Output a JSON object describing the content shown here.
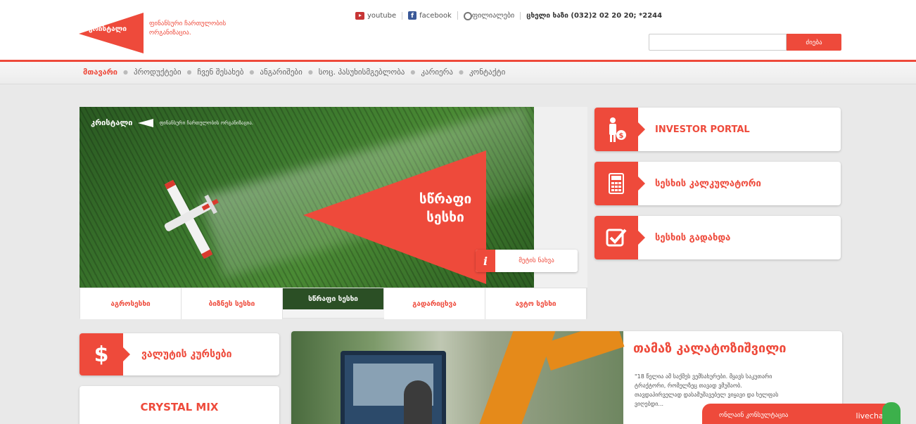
{
  "header": {
    "logo_text": "კრისტალი",
    "tagline": "ფინანსური ჩართულობის ორგანიზაცია.",
    "links": [
      {
        "label": "youtube",
        "icon": "youtube-icon"
      },
      {
        "label": "facebook",
        "icon": "facebook-icon"
      },
      {
        "label": "ფილიალები",
        "icon": "map-pin-icon"
      }
    ],
    "hotline": "ცხელი ხაზი (032)2 02 20 20; *2244",
    "search": {
      "placeholder": "",
      "button_label": "ძიება"
    }
  },
  "nav": {
    "items": [
      {
        "label": "მთავარი",
        "active": true
      },
      {
        "label": "პროდუქტები",
        "active": false
      },
      {
        "label": "ჩვენ შესახებ",
        "active": false
      },
      {
        "label": "ანგარიშები",
        "active": false
      },
      {
        "label": "სოც. პასუხისმგებლობა",
        "active": false
      },
      {
        "label": "კარიერა",
        "active": false
      },
      {
        "label": "კონტაქტი",
        "active": false
      }
    ]
  },
  "hero": {
    "brand": "კრისტალი",
    "brand_sub": "ფინანსური ჩართულობის ორგანიზაცია.",
    "title_line1": "სწრაფი",
    "title_line2": "სესხი",
    "more_label": "მეტის ნახვა"
  },
  "tabs": [
    {
      "label": "აგროსესხი",
      "active": false
    },
    {
      "label": "ბიზნეს სესხი",
      "active": false
    },
    {
      "label": "სწრაფი სესხი",
      "active": true
    },
    {
      "label": "გადარიცხვა",
      "active": false
    },
    {
      "label": "ავტო სესხი",
      "active": false
    }
  ],
  "side_cards": [
    {
      "label": "INVESTOR PORTAL",
      "icon": "investor-icon"
    },
    {
      "label": "სესხის კალკულატორი",
      "icon": "calculator-icon"
    },
    {
      "label": "სესხის გადახდა",
      "icon": "checkbox-icon"
    }
  ],
  "currency": {
    "label": "ვალუტის კურსები",
    "icon_symbol": "$"
  },
  "crystal_mix": {
    "label": "CRYSTAL MIX"
  },
  "testimonial": {
    "name": "თამაზ კალატოზიშვილი",
    "quote": "\"18 წელია ამ საქმეს ვემსახურები. მყავს საკუთარი ტრაქტორი, რომელზეც თავად ვმუშაობ. თავდაპირველად დასამუშავებელ ვიყავი და ხელფას ვიღებდი..."
  },
  "livechat": {
    "label": "ონლაინ კონსულტაცია",
    "brand": "livechat"
  },
  "colors": {
    "accent": "#ee4a3b",
    "field_green": "#3d7a2e",
    "livechat_green": "#3cb04b"
  }
}
